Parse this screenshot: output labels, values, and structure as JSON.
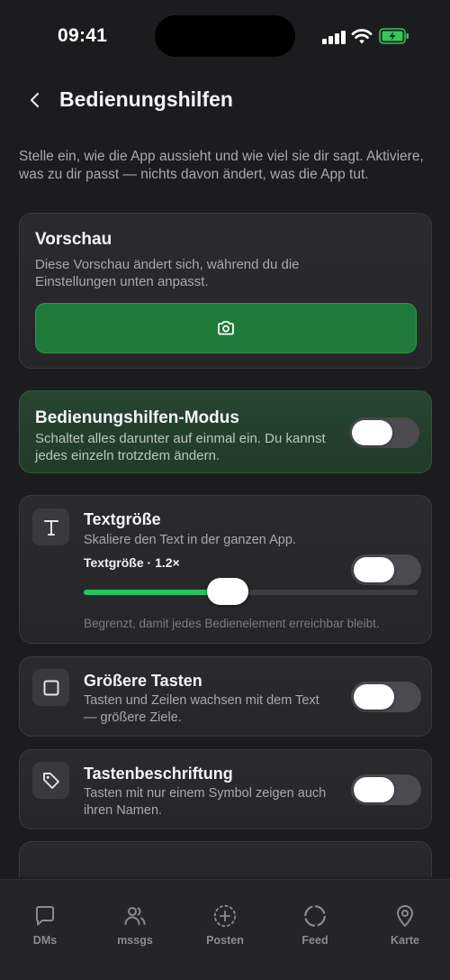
{
  "status_bar": {
    "time": "09:41"
  },
  "header": {
    "title": "Bedienungshilfen"
  },
  "intro": "Stelle ein, wie die App aussieht und wie viel sie dir sagt. Aktiviere, was zu dir passt — nichts davon ändert, was die App tut.",
  "preview": {
    "title": "Vorschau",
    "description": "Diese Vorschau ändert sich, während du die Einstellungen unten anpasst.",
    "button_icon": "camera-icon"
  },
  "mode": {
    "title": "Bedienungshilfen-Modus",
    "description": "Schaltet alles darunter auf einmal ein. Du kannst jedes einzeln trotzdem ändern.",
    "enabled": false
  },
  "settings": {
    "text_size": {
      "icon": "text-icon",
      "title": "Textgröße",
      "description": "Skaliere den Text in der ganzen App.",
      "slider_label": "Textgröße · 1.2×",
      "slider_fraction": 0.43,
      "note": "Begrenzt, damit jedes Bedienelement erreichbar bleibt.",
      "enabled": false
    },
    "larger_buttons": {
      "icon": "square-icon",
      "title": "Größere Tasten",
      "description": "Tasten und Zeilen wachsen mit dem Text — größere Ziele.",
      "enabled": false
    },
    "button_labels": {
      "icon": "tag-icon",
      "title": "Tastenbeschriftung",
      "description": "Tasten mit nur einem Symbol zeigen auch ihren Namen.",
      "enabled": false
    }
  },
  "tabs": [
    {
      "label": "DMs",
      "icon": "chat-bubble-icon"
    },
    {
      "label": "mssgs",
      "icon": "users-icon"
    },
    {
      "label": "Posten",
      "icon": "plus-circle-icon"
    },
    {
      "label": "Feed",
      "icon": "circle-icon"
    },
    {
      "label": "Karte",
      "icon": "map-pin-icon"
    }
  ],
  "colors": {
    "accent_green": "#22c55e",
    "preview_button": "#1f7a3a",
    "mode_card": "#26452f",
    "background": "#1c1c1e"
  }
}
